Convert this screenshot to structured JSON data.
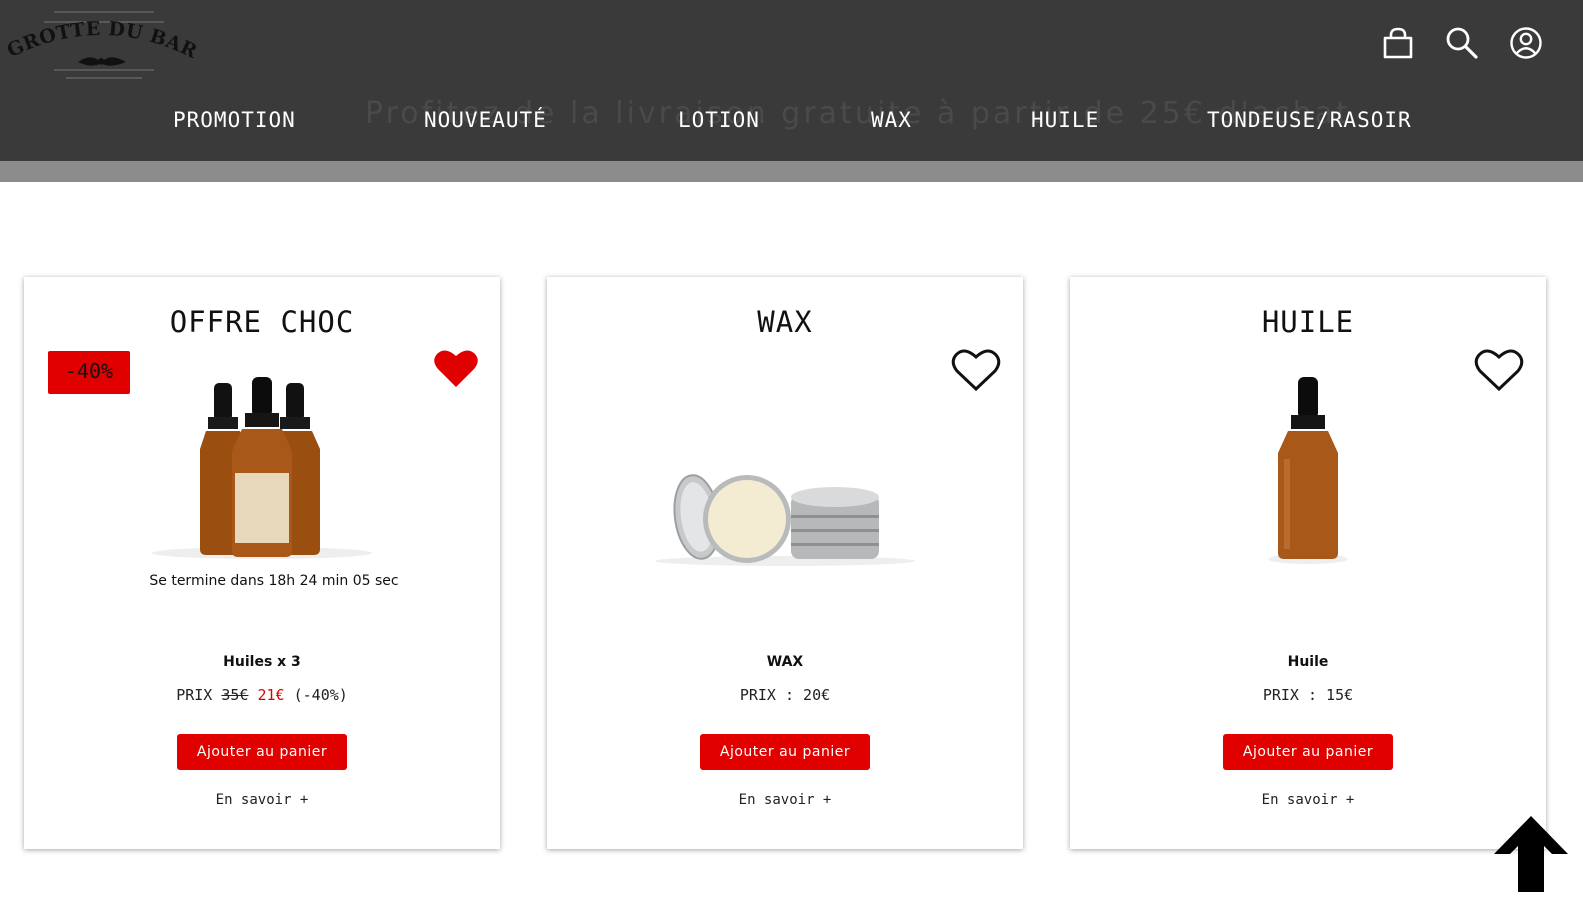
{
  "header": {
    "logo_text": "LA GROTTE DU BARBU",
    "banner_text": "Profitez de la livraison gratuite à partir de 25€ d'achat",
    "icons": [
      "cart-icon",
      "search-icon",
      "user-icon"
    ]
  },
  "nav": {
    "items": [
      {
        "label": "PROMOTION"
      },
      {
        "label": "NOUVEAUTÉ"
      },
      {
        "label": "LOTION"
      },
      {
        "label": "WAX"
      },
      {
        "label": "HUILE"
      },
      {
        "label": "TONDEUSE/RASOIR"
      }
    ]
  },
  "cards": [
    {
      "title": "OFFRE CHOC",
      "badge": "-40%",
      "favorited": true,
      "countdown": "Se termine dans 18h 24 min 05 sec",
      "product_name": "Huiles x 3",
      "price_prefix": "PRIX ",
      "price_old": "35€",
      "price_new": "21€",
      "price_discount": " (-40%)",
      "button": "Ajouter au panier",
      "more": "En savoir +"
    },
    {
      "title": "WAX",
      "favorited": false,
      "product_name": "WAX",
      "price": "PRIX : 20€",
      "button": "Ajouter au panier",
      "more": "En savoir +"
    },
    {
      "title": "HUILE",
      "favorited": false,
      "product_name": "Huile",
      "price": "PRIX : 15€",
      "button": "Ajouter au panier",
      "more": "En savoir +"
    }
  ],
  "colors": {
    "header_bg": "#3a3a3a",
    "accent_red": "#e10000",
    "subbar": "#8c8c8c"
  }
}
